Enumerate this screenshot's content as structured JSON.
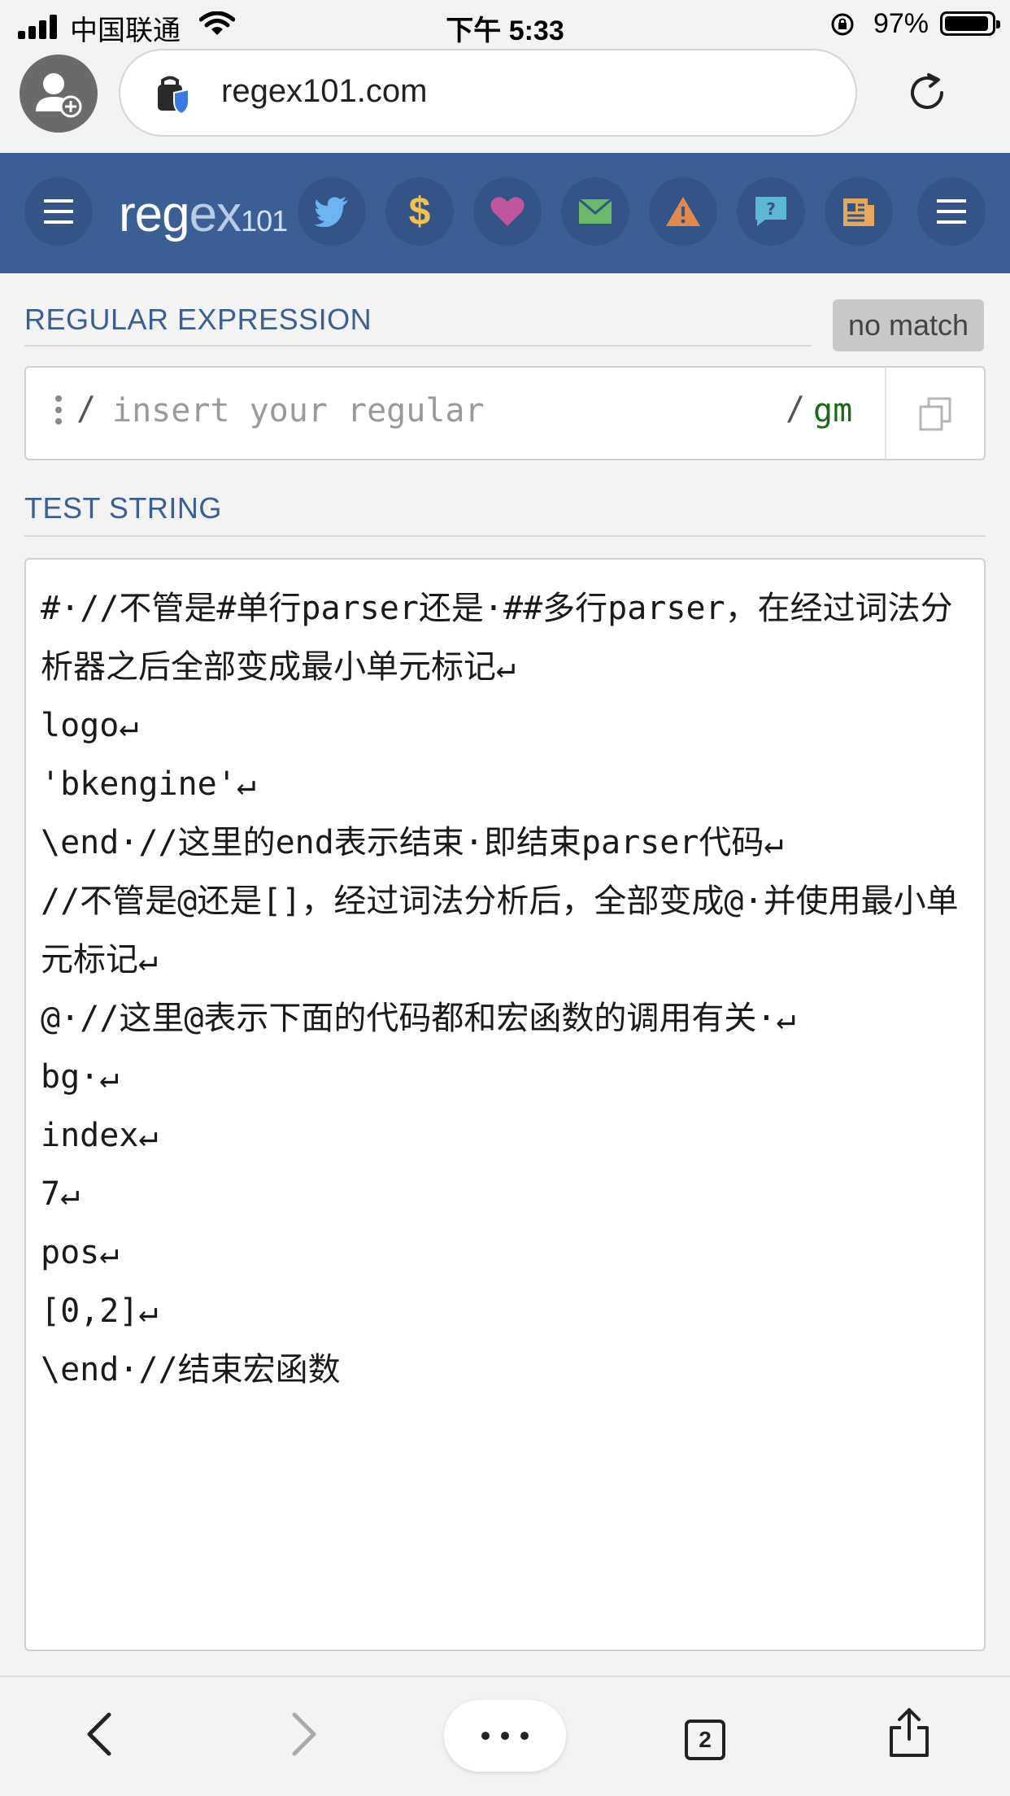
{
  "status_bar": {
    "carrier": "中国联通",
    "time": "下午 5:33",
    "battery": "97%"
  },
  "browser": {
    "url": "regex101.com"
  },
  "header": {
    "logo_main": "reg",
    "logo_ex": "ex",
    "logo_num": "101"
  },
  "regex_section": {
    "title": "REGULAR EXPRESSION",
    "match_status": "no match",
    "delimiter_open": "/",
    "placeholder": "insert your regular",
    "delimiter_close": "/",
    "flags": "gm"
  },
  "test_section": {
    "title": "TEST STRING",
    "lines": [
      "#·//不管是#单行parser还是·##多行parser，在经过词法分析器之后全部变成最小单元标记↵",
      "logo↵",
      "'bkengine'↵",
      "\\end·//这里的end表示结束·即结束parser代码↵",
      "//不管是@还是[]，经过词法分析后，全部变成@·并使用最小单元标记↵",
      "@·//这里@表示下面的代码都和宏函数的调用有关·↵",
      "bg·↵",
      "index↵",
      "7↵",
      "pos↵",
      "[0,2]↵",
      "\\end·//结束宏函数"
    ]
  },
  "colors": {
    "nav": "#3b5f94",
    "section_title": "#3b5f94",
    "flags": "#1c6b1c"
  },
  "icons": [
    "menu-icon",
    "twitter-icon",
    "dollar-icon",
    "heart-icon",
    "mail-icon",
    "warning-icon",
    "help-icon",
    "library-icon",
    "menu-icon",
    "back-icon",
    "forward-icon",
    "more-icon",
    "tabs-icon",
    "share-icon"
  ],
  "bottom_bar": {
    "tab_count": "2"
  }
}
